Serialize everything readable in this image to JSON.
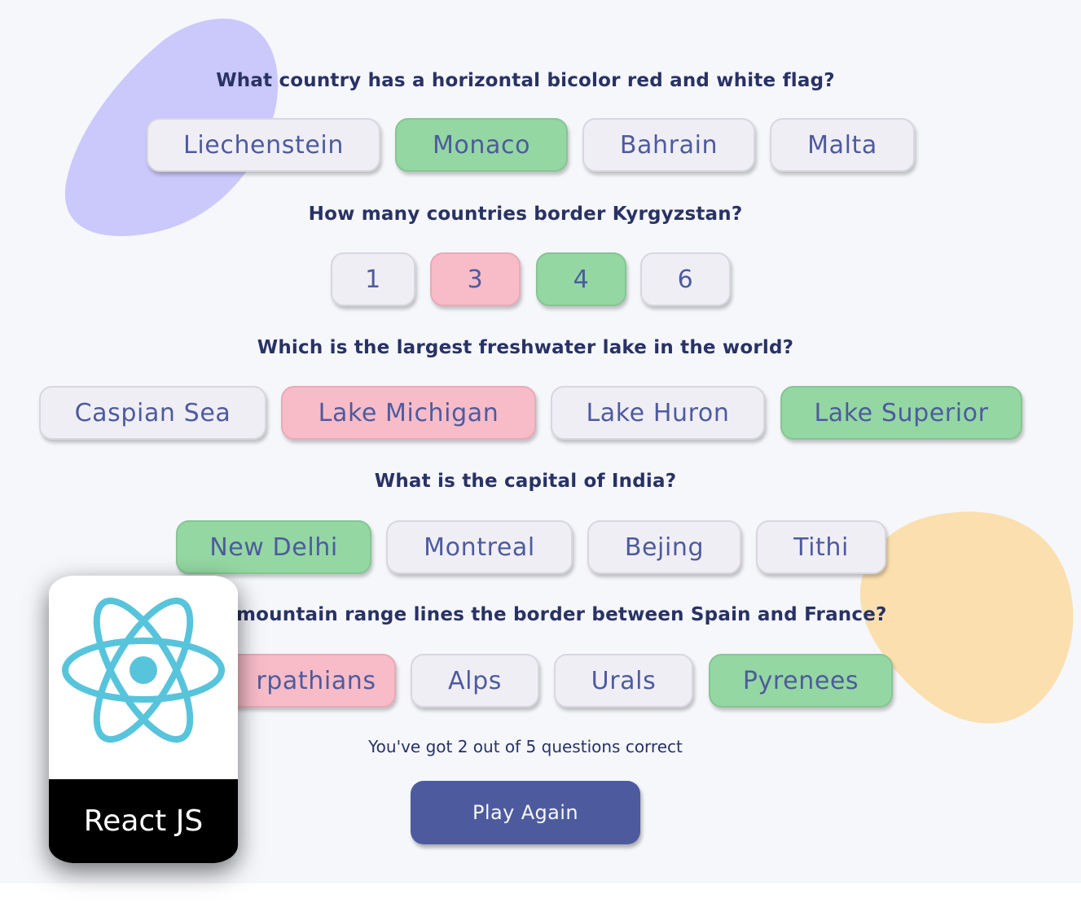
{
  "quiz": {
    "questions": [
      {
        "text": "What country has a horizontal bicolor red and white flag?",
        "answers": [
          {
            "label": "Liechenstein",
            "state": "neutral"
          },
          {
            "label": "Monaco",
            "state": "correct"
          },
          {
            "label": "Bahrain",
            "state": "neutral"
          },
          {
            "label": "Malta",
            "state": "neutral"
          }
        ]
      },
      {
        "text": "How many countries border Kyrgyzstan?",
        "answers": [
          {
            "label": "1",
            "state": "neutral"
          },
          {
            "label": "3",
            "state": "wrong"
          },
          {
            "label": "4",
            "state": "correct"
          },
          {
            "label": "6",
            "state": "neutral"
          }
        ]
      },
      {
        "text": "Which is the largest freshwater lake in the world?",
        "answers": [
          {
            "label": "Caspian Sea",
            "state": "neutral"
          },
          {
            "label": "Lake Michigan",
            "state": "wrong"
          },
          {
            "label": "Lake Huron",
            "state": "neutral"
          },
          {
            "label": "Lake Superior",
            "state": "correct"
          }
        ]
      },
      {
        "text": "What is the capital of India?",
        "answers": [
          {
            "label": "New Delhi",
            "state": "correct"
          },
          {
            "label": "Montreal",
            "state": "neutral"
          },
          {
            "label": "Bejing",
            "state": "neutral"
          },
          {
            "label": "Tithi",
            "state": "neutral"
          }
        ]
      },
      {
        "text": "mountain range lines the border between Spain and France?",
        "answers": [
          {
            "label": "rpathians",
            "state": "wrong"
          },
          {
            "label": "Alps",
            "state": "neutral"
          },
          {
            "label": "Urals",
            "state": "neutral"
          },
          {
            "label": "Pyrenees",
            "state": "correct"
          }
        ]
      }
    ],
    "score_text": "You've got 2 out of 5 questions correct",
    "play_again_label": "Play Again"
  },
  "badge": {
    "label": "React JS",
    "icon": "react-atom-icon",
    "icon_color": "#58c4dc"
  },
  "colors": {
    "background": "#f5f7fb",
    "correct": "#94d7a2",
    "wrong": "#f8bcc8",
    "neutral": "#f0eef5",
    "primary": "#4d5b9e",
    "text_dark": "#293264",
    "blob_purple": "#cbc8fb",
    "blob_yellow": "#fbdfae"
  }
}
